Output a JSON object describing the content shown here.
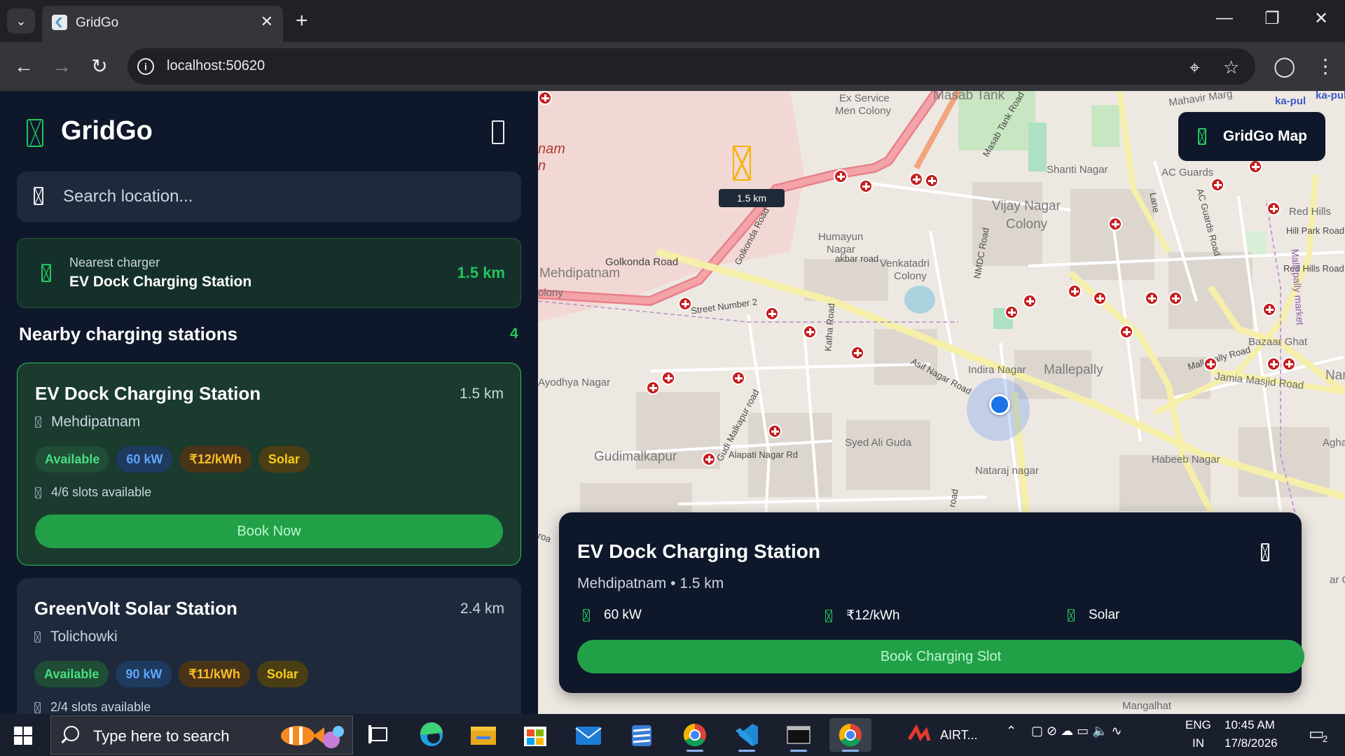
{
  "browser": {
    "tab_title": "GridGo",
    "url": "localhost:50620",
    "icons": [
      "chevron-down-icon",
      "close-icon",
      "plus-icon",
      "minimize-icon",
      "restore-icon",
      "back-icon",
      "forward-icon",
      "reload-icon",
      "info-icon",
      "location-icon",
      "star-icon",
      "profile-icon",
      "kebab-menu-icon"
    ]
  },
  "app": {
    "brand": "GridGo",
    "search_placeholder": "Search location...",
    "nearest": {
      "label": "Nearest charger",
      "name": "EV Dock Charging Station",
      "distance": "1.5 km"
    },
    "section_title": "Nearby charging stations",
    "section_count": "4",
    "stations": [
      {
        "name": "EV Dock Charging Station",
        "distance": "1.5 km",
        "location": "Mehdipatnam",
        "status": "Available",
        "power": "60 kW",
        "price": "₹12/kWh",
        "source": "Solar",
        "slots": "4/6 slots available",
        "cta": "Book Now"
      },
      {
        "name": "GreenVolt Solar Station",
        "distance": "2.4 km",
        "location": "Tolichowki",
        "status": "Available",
        "power": "90 kW",
        "price": "₹11/kWh",
        "source": "Solar",
        "slots": "2/4 slots available"
      }
    ]
  },
  "map": {
    "badge": "GridGo Map",
    "pin_label": "1.5 km",
    "labels": {
      "ex_service": "Ex Service",
      "men_colony": "Men Colony",
      "masab_tank": "Masab Tank",
      "masab_tank_road": "Masab Tank Road",
      "mahavir_marg": "Mahavir Marg",
      "ka_pul": "ka-pul",
      "ka_pul2": "ka-pul",
      "nam": "nam",
      "n": "n",
      "shanti_nagar": "Shanti Nagar",
      "ac_guards": "AC Guards",
      "ac_guards_road": "AC Guards Road",
      "lane": "Lane",
      "vijay_nagar": "Vijay Nagar",
      "colony": "Colony",
      "red_hills": "Red Hills",
      "hill_park_road": "Hill Park Road",
      "red_hills_road": "Red Hills Road",
      "golkonda_road_diag": "Golkonda Road",
      "humayun": "Humayun",
      "nagar": "Nagar",
      "akbar_road": "akbar road",
      "venkatadri": "Venkatadri",
      "venk_colony": "Colony",
      "nmdc_road": "NMDC Road",
      "golkonda_road": "Golkonda Road",
      "mehdipatnam": "Mehdipatnam",
      "olony": "olony",
      "street_number_2": "Street Number 2",
      "katha_road": "Katha Road",
      "asif_nagar_road": "Asif Nagar Road",
      "indira_nagar": "Indira Nagar",
      "mallepally": "Mallepally",
      "mallepally_road": "Mallepally Road",
      "bazaar_ghat": "Bazaar Ghat",
      "jamia_masjid_road": "Jamia Masjid Road",
      "nar": "Nar",
      "ayodhya_nagar": "Ayodhya Nagar",
      "gudi_malkapur_road": "Gudi Malkapur road",
      "gudimalkapur": "Gudimalkapur",
      "alapati_nagar_rd": "Alapati Nagar Rd",
      "syed_ali_guda": "Syed Ali Guda",
      "nataraj_nagar": "Nataraj nagar",
      "habeeb_nagar": "Habeeb Nagar",
      "aghapu": "Aghapu",
      "ar_cu": "ar Cu",
      "mangalhat": "Mangalhat",
      "mallepally_market": "Mallepally market",
      "roa": "roa",
      "road": "road"
    },
    "popup": {
      "name": "EV Dock Charging Station",
      "subtitle": "Mehdipatnam • 1.5 km",
      "power": "60 kW",
      "price": "₹12/kWh",
      "source": "Solar",
      "cta": "Book Charging Slot"
    }
  },
  "taskbar": {
    "search_placeholder": "Type here to search",
    "network_label": "AIRT...",
    "lang_top": "ENG",
    "lang_bottom": "IN",
    "time": "10:45 AM",
    "date": "17/8/2026",
    "notifications": "2"
  }
}
